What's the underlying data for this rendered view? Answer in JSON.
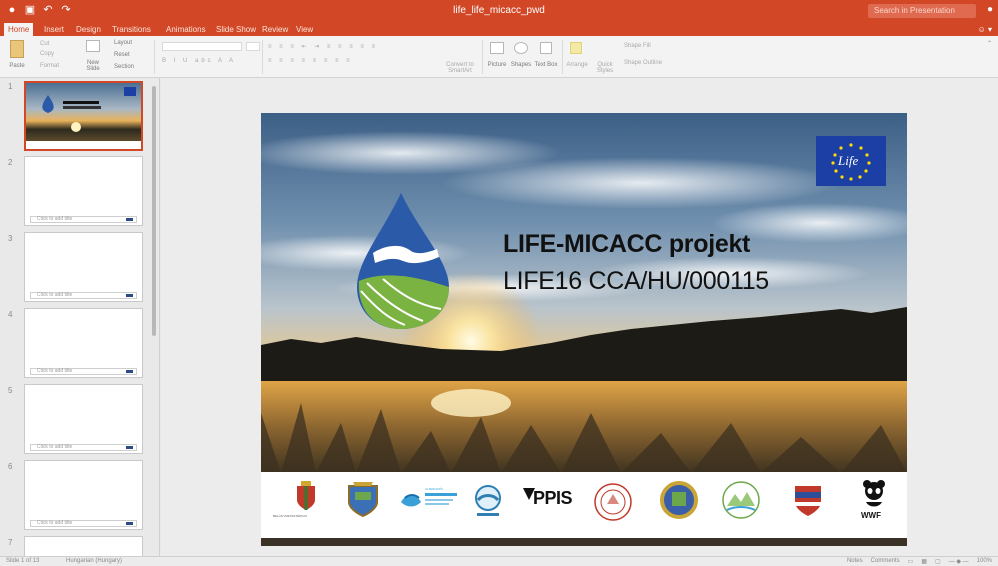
{
  "window": {
    "doc_title": "life_life_micacc_pwd",
    "search_placeholder": "Search in Presentation",
    "qat_icons": [
      "save-icon",
      "undo-icon",
      "redo-icon"
    ]
  },
  "ribbon": {
    "tabs": [
      "Home",
      "Insert",
      "Design",
      "Transitions",
      "Animations",
      "Slide Show",
      "Review",
      "View"
    ],
    "active_tab": "Home",
    "share_label": "Share",
    "paste_label": "Paste",
    "cut_label": "Cut",
    "copy_label": "Copy",
    "format_label": "Format",
    "new_slide_label": "New Slide",
    "layout_label": "Layout",
    "reset_label": "Reset",
    "section_label": "Section",
    "convert_smartart_label": "Convert to SmartArt",
    "picture_label": "Picture",
    "shapes_label": "Shapes",
    "text_box_label": "Text Box",
    "arrange_label": "Arrange",
    "quick_styles_label": "Quick Styles",
    "shape_fill_label": "Shape Fill",
    "shape_outline_label": "Shape Outline"
  },
  "thumbnails": {
    "numbers": [
      "1",
      "2",
      "3",
      "4",
      "5",
      "6",
      "7"
    ],
    "note_label": "Click to add title"
  },
  "slide": {
    "title": "LIFE-MICACC projekt",
    "subtitle": "LIFE16 CCA/HU/000115",
    "eu_logo_text": "Life",
    "logos": [
      {
        "name": "hungary-ministry-logo",
        "caption": "BELÜGYMINISZTÉRIUM"
      },
      {
        "name": "municipal-coat-of-arms-logo",
        "caption": ""
      },
      {
        "name": "water-directorate-logo",
        "caption": "ALTERNATÍV"
      },
      {
        "name": "circle-water-logo",
        "caption": ""
      },
      {
        "name": "ppis-logo",
        "caption": "PPIS"
      },
      {
        "name": "seal-logo",
        "caption": ""
      },
      {
        "name": "town-shield-logo",
        "caption": ""
      },
      {
        "name": "green-landscape-logo",
        "caption": ""
      },
      {
        "name": "red-blue-shield-logo",
        "caption": ""
      },
      {
        "name": "wwf-logo",
        "caption": "WWF"
      }
    ]
  },
  "statusbar": {
    "slide_info": "Slide 1 of 13",
    "language": "Hungarian (Hungary)",
    "notes_label": "Notes",
    "comments_label": "Comments",
    "zoom": "100%"
  },
  "colors": {
    "accent": "#d24726",
    "eu_blue": "#1c3fa6",
    "drop_blue": "#2a5aa8",
    "leaf_green": "#7bb342"
  }
}
